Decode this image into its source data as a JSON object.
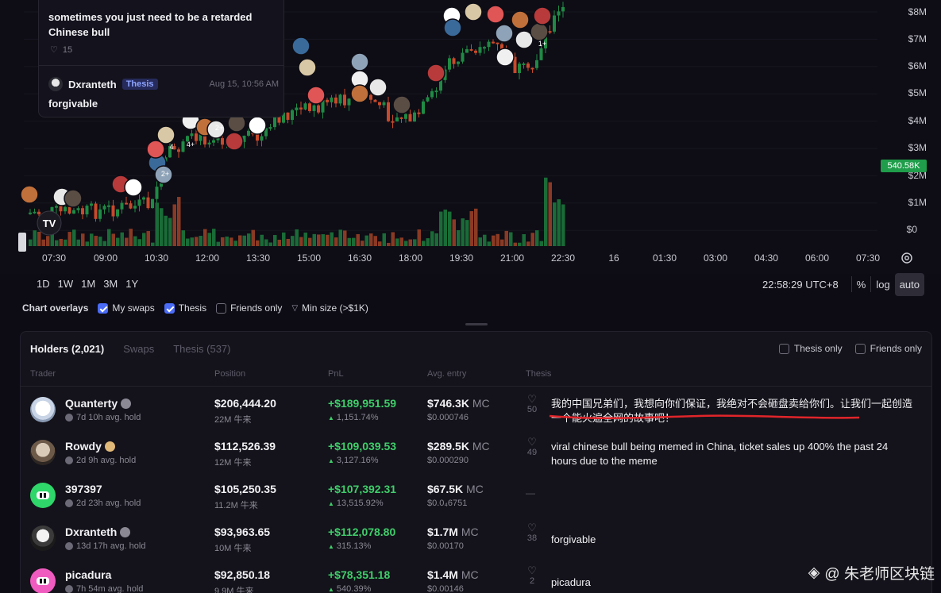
{
  "chart": {
    "price_labels": [
      "$8M",
      "$7M",
      "$6M",
      "$5M",
      "$4M",
      "$3M",
      "$2M",
      "$1M",
      "$0"
    ],
    "current_price_badge": "540.58K",
    "time_labels": [
      "07:30",
      "09:00",
      "10:30",
      "12:00",
      "13:30",
      "15:00",
      "16:30",
      "18:00",
      "19:30",
      "21:00",
      "22:30",
      "16",
      "01:30",
      "03:00",
      "04:30",
      "06:00",
      "07:30"
    ],
    "up_color": "#1f8a44",
    "down_color": "#c8492b",
    "bubble_badges": [
      "4",
      "4+",
      "2+",
      "2+",
      "1+"
    ]
  },
  "popup": {
    "text": "sometimes you just need to be a retarded Chinese bull",
    "likes": "15",
    "author": "Dxranteth",
    "badge": "Thesis",
    "time": "Aug 15, 10:56 AM",
    "comment": "forgivable"
  },
  "toolbar": {
    "ranges": [
      "1D",
      "1W",
      "1M",
      "3M",
      "1Y"
    ],
    "clock": "22:58:29 UTC+8",
    "percent": "%",
    "log": "log",
    "auto": "auto"
  },
  "overlays": {
    "title": "Chart overlays",
    "my_swaps": "My swaps",
    "thesis": "Thesis",
    "friends_only": "Friends only",
    "min_size": "Min size (>$1K)"
  },
  "panel": {
    "tab_holders": "Holders (2,021)",
    "tab_swaps": "Swaps",
    "tab_thesis": "Thesis (537)",
    "filter_thesis_only": "Thesis only",
    "filter_friends_only": "Friends only",
    "col_trader": "Trader",
    "col_position": "Position",
    "col_pnl": "PnL",
    "col_entry": "Avg. entry",
    "col_thesis": "Thesis"
  },
  "holders": [
    {
      "name": "Quanterty",
      "hold": "7d 10h avg. hold",
      "position": "$206,444.20",
      "tokens": "22M 牛来",
      "pnl": "+$189,951.59",
      "pnl_pct": "1,151.74%",
      "entry_mc": "$746.3K",
      "mc": "MC",
      "entry_price": "$0.000746",
      "likes": "50",
      "thesis": "我的中国兄弟们，我想向你们保证，我绝对不会砸盘卖给你们。让我们一起创造一个能火遍全网的故事吧！"
    },
    {
      "name": "Rowdy",
      "hold": "2d 9h avg. hold",
      "position": "$112,526.39",
      "tokens": "12M 牛来",
      "pnl": "+$109,039.53",
      "pnl_pct": "3,127.16%",
      "entry_mc": "$289.5K",
      "mc": "MC",
      "entry_price": "$0.000290",
      "likes": "49",
      "thesis": "viral chinese bull being memed in China, ticket sales up 400% the past 24 hours due to the meme"
    },
    {
      "name": "397397",
      "hold": "2d 23h avg. hold",
      "position": "$105,250.35",
      "tokens": "11.2M 牛来",
      "pnl": "+$107,392.31",
      "pnl_pct": "13,515.92%",
      "entry_mc": "$67.5K",
      "mc": "MC",
      "entry_price": "$0.0₄6751",
      "likes": "",
      "thesis": "—"
    },
    {
      "name": "Dxranteth",
      "hold": "13d 17h avg. hold",
      "position": "$93,963.65",
      "tokens": "10M 牛来",
      "pnl": "+$112,078.80",
      "pnl_pct": "315.13%",
      "entry_mc": "$1.7M",
      "mc": "MC",
      "entry_price": "$0.00170",
      "likes": "38",
      "thesis": "forgivable"
    },
    {
      "name": "picadura",
      "hold": "7h 54m avg. hold",
      "position": "$92,850.18",
      "tokens": "9.9M 牛来",
      "pnl": "+$78,351.18",
      "pnl_pct": "540.39%",
      "entry_mc": "$1.4M",
      "mc": "MC",
      "entry_price": "$0.00146",
      "likes": "2",
      "thesis": "picadura"
    }
  ],
  "watermark": "@ 朱老师区块链"
}
